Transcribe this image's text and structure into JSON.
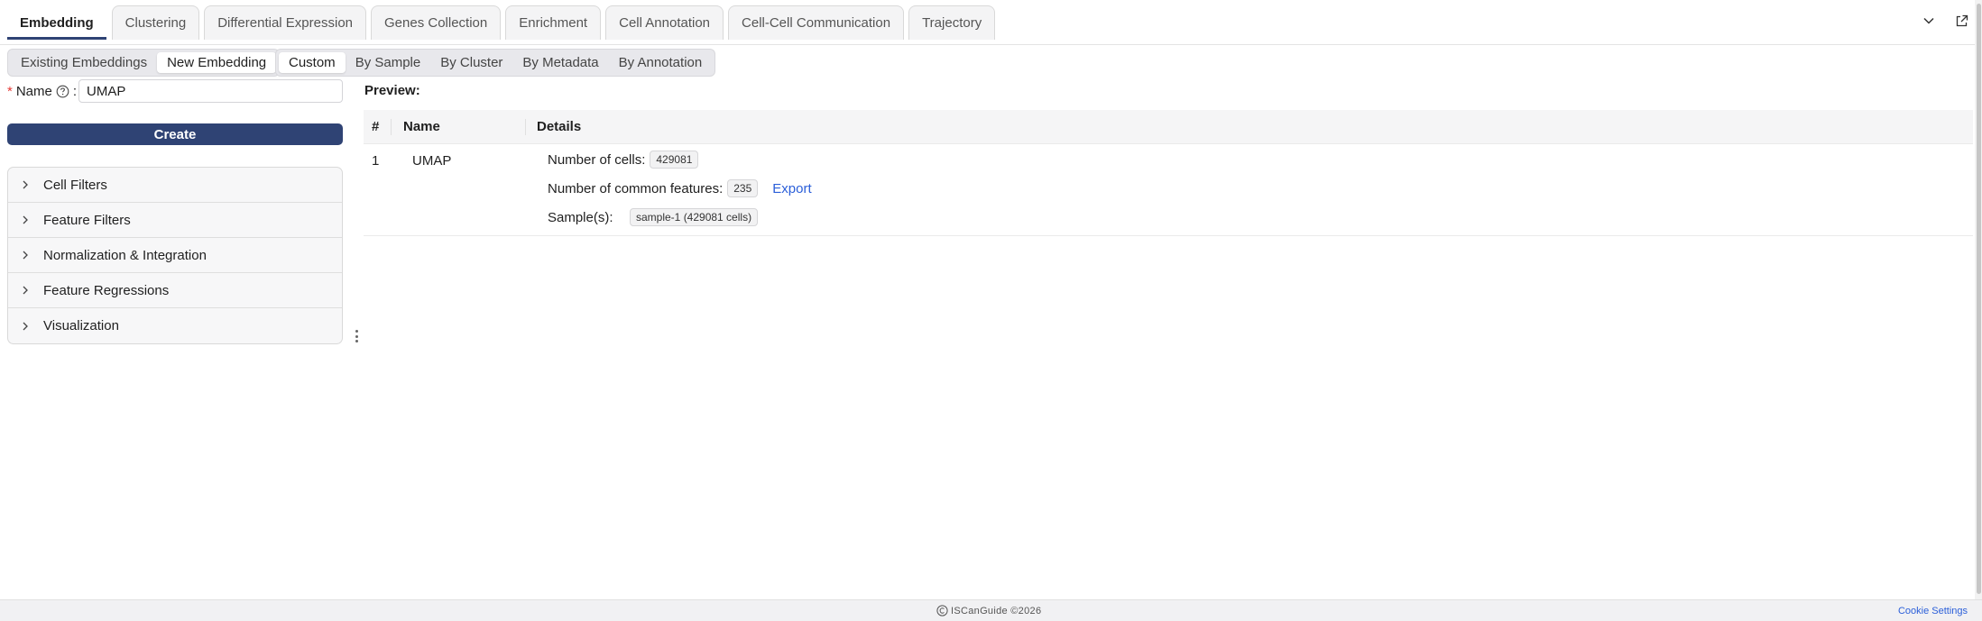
{
  "tabs": [
    {
      "label": "Embedding",
      "active": true
    },
    {
      "label": "Clustering",
      "active": false
    },
    {
      "label": "Differential Expression",
      "active": false
    },
    {
      "label": "Genes Collection",
      "active": false
    },
    {
      "label": "Enrichment",
      "active": false
    },
    {
      "label": "Cell Annotation",
      "active": false
    },
    {
      "label": "Cell-Cell Communication",
      "active": false
    },
    {
      "label": "Trajectory",
      "active": false
    }
  ],
  "tab_tools": {
    "collapse_icon": "chevron-down-icon",
    "popout_icon": "external-link-icon"
  },
  "mode_switch": [
    {
      "label": "Existing Embeddings",
      "active": false
    },
    {
      "label": "New Embedding",
      "active": true
    }
  ],
  "source_switch": [
    {
      "label": "Custom",
      "active": true
    },
    {
      "label": "By Sample",
      "active": false
    },
    {
      "label": "By Cluster",
      "active": false
    },
    {
      "label": "By Metadata",
      "active": false
    },
    {
      "label": "By Annotation",
      "active": false
    }
  ],
  "form": {
    "required_mark": "*",
    "name_label": "Name",
    "name_colon": ":",
    "name_value": "UMAP",
    "create_label": "Create"
  },
  "panels": [
    {
      "label": "Cell Filters"
    },
    {
      "label": "Feature Filters"
    },
    {
      "label": "Normalization & Integration"
    },
    {
      "label": "Feature Regressions"
    },
    {
      "label": "Visualization"
    }
  ],
  "preview": {
    "title": "Preview:",
    "columns": [
      "#",
      "Name",
      "Details"
    ],
    "rows": [
      {
        "index": "1",
        "name": "UMAP",
        "cells_label": "Number of cells:",
        "cells_value": "429081",
        "features_label": "Number of common features:",
        "features_value": "235",
        "export_label": "Export",
        "samples_label": "Sample(s):",
        "samples": [
          "sample-1 (429081 cells)"
        ]
      }
    ]
  },
  "footer": {
    "brand": "ISCanGuide ©2026",
    "cookie_label": "Cookie Settings"
  },
  "colors": {
    "accent": "#2f4374",
    "link": "#2b5fd9",
    "required": "#e53935"
  }
}
